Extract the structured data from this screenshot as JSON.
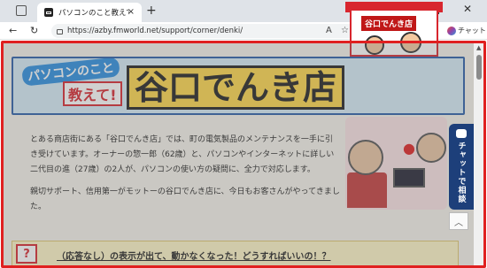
{
  "browser": {
    "tab_title": "パソコンのこと教えて！谷口でんき店：",
    "tab_close": "×",
    "new_tab": "+",
    "url": "https://azby.fmworld.net/support/corner/denki/",
    "nav_back": "←",
    "nav_reload": "↻",
    "min": "—",
    "close": "✕",
    "chat_label": "チャット"
  },
  "banner": {
    "pc_text": "パソコンのこと",
    "teach_text": "教えて!",
    "title": "谷口でんき店",
    "shop_sign": "谷口でんき店"
  },
  "intro": {
    "paragraph1": "とある商店街にある「谷口でんき店」では、町の電気製品のメンテナンスを一手に引き受けています。オーナーの惣一郎（62歳）と、パソコンやインターネットに詳しい二代目の進（27歳）の2人が、パソコンの使い方の疑問に、全力で対応します。",
    "paragraph2": "親切サポート、信用第一がモットーの谷口でんき店に、今日もお客さんがやってきました。"
  },
  "chat_tab": {
    "label": "チャットで相談"
  },
  "scroll_top": "︿",
  "faq": {
    "icon": "?",
    "text": "（応答なし）の表示が出て、動かなくなった！どうすればいいの！？"
  }
}
